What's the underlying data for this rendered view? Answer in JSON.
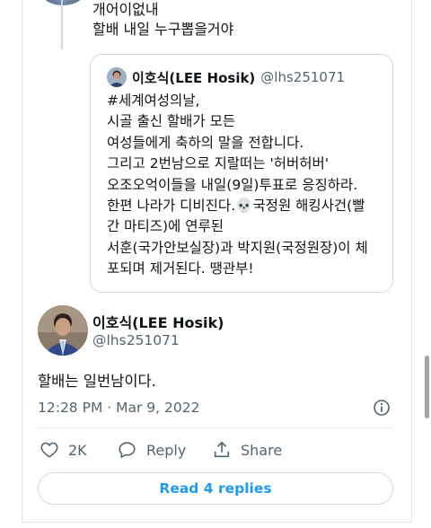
{
  "reply": {
    "text": "개어이없내\n할배 내일 누구뽑을거야"
  },
  "quoted_tweet": {
    "name": "이호식(LEE Hosik)",
    "handle": "@lhs251071",
    "text": "#세계여성의날,\n시골 출신 할배가 모든\n여성들에게 축하의 말을 전합니다.\n그리고 2번남으로 지랄떠는 '허버허버'\n오조오억이들을 내일(9일)투표로 응징하라.\n한편 나라가 디비진다.💀국정원 해킹사건(빨\n간 마티즈)에 연루된\n서훈(국가안보실장)과 박지원(국정원장)이 체\n포되며 제거된다. 땡관부!"
  },
  "tweet": {
    "name": "이호식(LEE Hosik)",
    "handle": "@lhs251071",
    "text": "할배는 일번남이다.",
    "timestamp": "12:28 PM · Mar 9, 2022"
  },
  "actions": {
    "like_count": "2K",
    "reply_label": "Reply",
    "share_label": "Share"
  },
  "read_replies_label": "Read 4 replies",
  "colors": {
    "accent": "#1d9bf0",
    "secondary_text": "#536471",
    "border": "#cfd9de"
  },
  "icons": [
    "heart-icon",
    "reply-bubble-icon",
    "share-icon",
    "info-icon"
  ]
}
